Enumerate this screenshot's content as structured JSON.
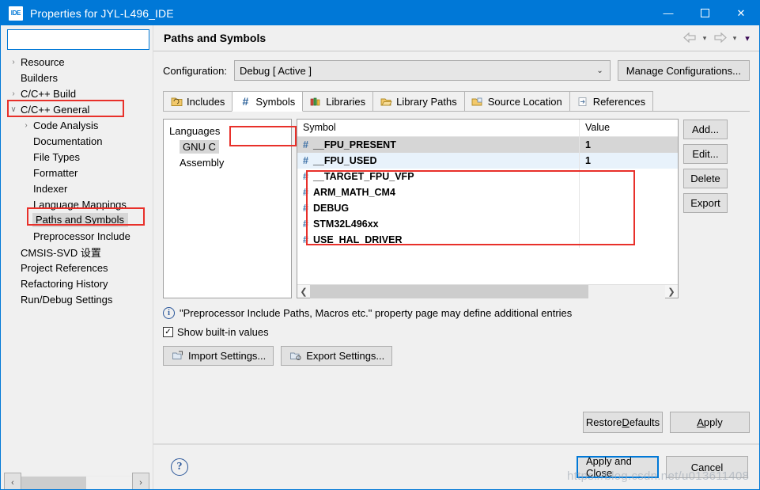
{
  "window": {
    "title": "Properties for JYL-L496_IDE",
    "app_icon": "ide-icon",
    "minimize": "—",
    "maximize": "☐",
    "close": "✕"
  },
  "sidebar": {
    "filter": {
      "value": "",
      "placeholder": ""
    },
    "items": [
      {
        "label": "Resource",
        "arrow": "›",
        "indent": 0,
        "selected": false
      },
      {
        "label": "Builders",
        "arrow": "",
        "indent": 0,
        "selected": false
      },
      {
        "label": "C/C++ Build",
        "arrow": "›",
        "indent": 0,
        "selected": false
      },
      {
        "label": "C/C++ General",
        "arrow": "∨",
        "indent": 0,
        "selected": false
      },
      {
        "label": "Code Analysis",
        "arrow": "›",
        "indent": 1,
        "selected": false
      },
      {
        "label": "Documentation",
        "arrow": "",
        "indent": 1,
        "selected": false
      },
      {
        "label": "File Types",
        "arrow": "",
        "indent": 1,
        "selected": false
      },
      {
        "label": "Formatter",
        "arrow": "",
        "indent": 1,
        "selected": false
      },
      {
        "label": "Indexer",
        "arrow": "",
        "indent": 1,
        "selected": false
      },
      {
        "label": "Language Mappings",
        "arrow": "",
        "indent": 1,
        "selected": false
      },
      {
        "label": "Paths and Symbols",
        "arrow": "",
        "indent": 1,
        "selected": true
      },
      {
        "label": "Preprocessor Include",
        "arrow": "",
        "indent": 1,
        "selected": false
      },
      {
        "label": "CMSIS-SVD 设置",
        "arrow": "",
        "indent": 0,
        "selected": false
      },
      {
        "label": "Project References",
        "arrow": "",
        "indent": 0,
        "selected": false
      },
      {
        "label": "Refactoring History",
        "arrow": "",
        "indent": 0,
        "selected": false
      },
      {
        "label": "Run/Debug Settings",
        "arrow": "",
        "indent": 0,
        "selected": false
      }
    ],
    "scroll_left": "‹",
    "scroll_right": "›"
  },
  "page": {
    "title": "Paths and Symbols",
    "nav_back": "⇦",
    "nav_back_menu": "▾",
    "nav_forward": "⇨",
    "nav_forward_menu": "▾",
    "view_menu": "▾"
  },
  "configuration": {
    "label": "Configuration:",
    "value": "Debug  [ Active ]",
    "dropdown_arrow": "⌄",
    "manage_button": "Manage Configurations..."
  },
  "tabs": [
    {
      "label": "Includes",
      "icon": "includes-folder-icon",
      "active": false
    },
    {
      "label": "Symbols",
      "icon": "hash-icon",
      "active": true
    },
    {
      "label": "Libraries",
      "icon": "books-icon",
      "active": false
    },
    {
      "label": "Library Paths",
      "icon": "open-folder-icon",
      "active": false
    },
    {
      "label": "Source Location",
      "icon": "source-folder-icon",
      "active": false
    },
    {
      "label": "References",
      "icon": "references-page-icon",
      "active": false
    }
  ],
  "languages": {
    "header": "Languages",
    "items": [
      {
        "label": "GNU C",
        "selected": true
      },
      {
        "label": "Assembly",
        "selected": false
      }
    ]
  },
  "symbols_table": {
    "columns": [
      "Symbol",
      "Value"
    ],
    "rows": [
      {
        "hash": "#",
        "symbol": "__FPU_PRESENT",
        "value": "1",
        "state": "selected"
      },
      {
        "hash": "#",
        "symbol": "__FPU_USED",
        "value": "1",
        "state": "alt"
      },
      {
        "hash": "#",
        "symbol": "__TARGET_FPU_VFP",
        "value": "",
        "state": ""
      },
      {
        "hash": "#",
        "symbol": "ARM_MATH_CM4",
        "value": "",
        "state": ""
      },
      {
        "hash": "#",
        "symbol": "DEBUG",
        "value": "",
        "state": ""
      },
      {
        "hash": "#",
        "symbol": "STM32L496xx",
        "value": "",
        "state": ""
      },
      {
        "hash": "#",
        "symbol": "USE_HAL_DRIVER",
        "value": "",
        "state": ""
      }
    ],
    "scroll_left": "❮",
    "scroll_right": "❯"
  },
  "side_buttons": [
    {
      "label": "Add..."
    },
    {
      "label": "Edit..."
    },
    {
      "label": "Delete"
    },
    {
      "label": "Export"
    }
  ],
  "note": {
    "icon": "info-icon",
    "glyph": "i",
    "text": "\"Preprocessor Include Paths, Macros etc.\" property page may define additional entries"
  },
  "show_builtin": {
    "label": "Show built-in values",
    "checked": true,
    "check_glyph": "✓"
  },
  "io_buttons": [
    {
      "label": "Import Settings...",
      "icon": "import-settings-icon"
    },
    {
      "label": "Export Settings...",
      "icon": "export-settings-icon"
    }
  ],
  "apply_row": [
    {
      "label_pre": "Restore ",
      "mnemonic": "D",
      "label_post": "efaults",
      "name": "restore-defaults-button"
    },
    {
      "label_pre": "",
      "mnemonic": "A",
      "label_post": "pply",
      "name": "apply-button"
    }
  ],
  "footer": {
    "help_glyph": "?",
    "apply_and_close": "Apply and Close",
    "cancel": "Cancel"
  },
  "watermark": "https://blog.csdn.net/u013611408",
  "colors": {
    "titlebar": "#0078d7",
    "accent": "#0078d7",
    "annotation_red": "#e8302a",
    "row_selected": "#d6d6d6",
    "row_alt": "#e8f2fb",
    "hash_blue": "#3a6ea5"
  }
}
